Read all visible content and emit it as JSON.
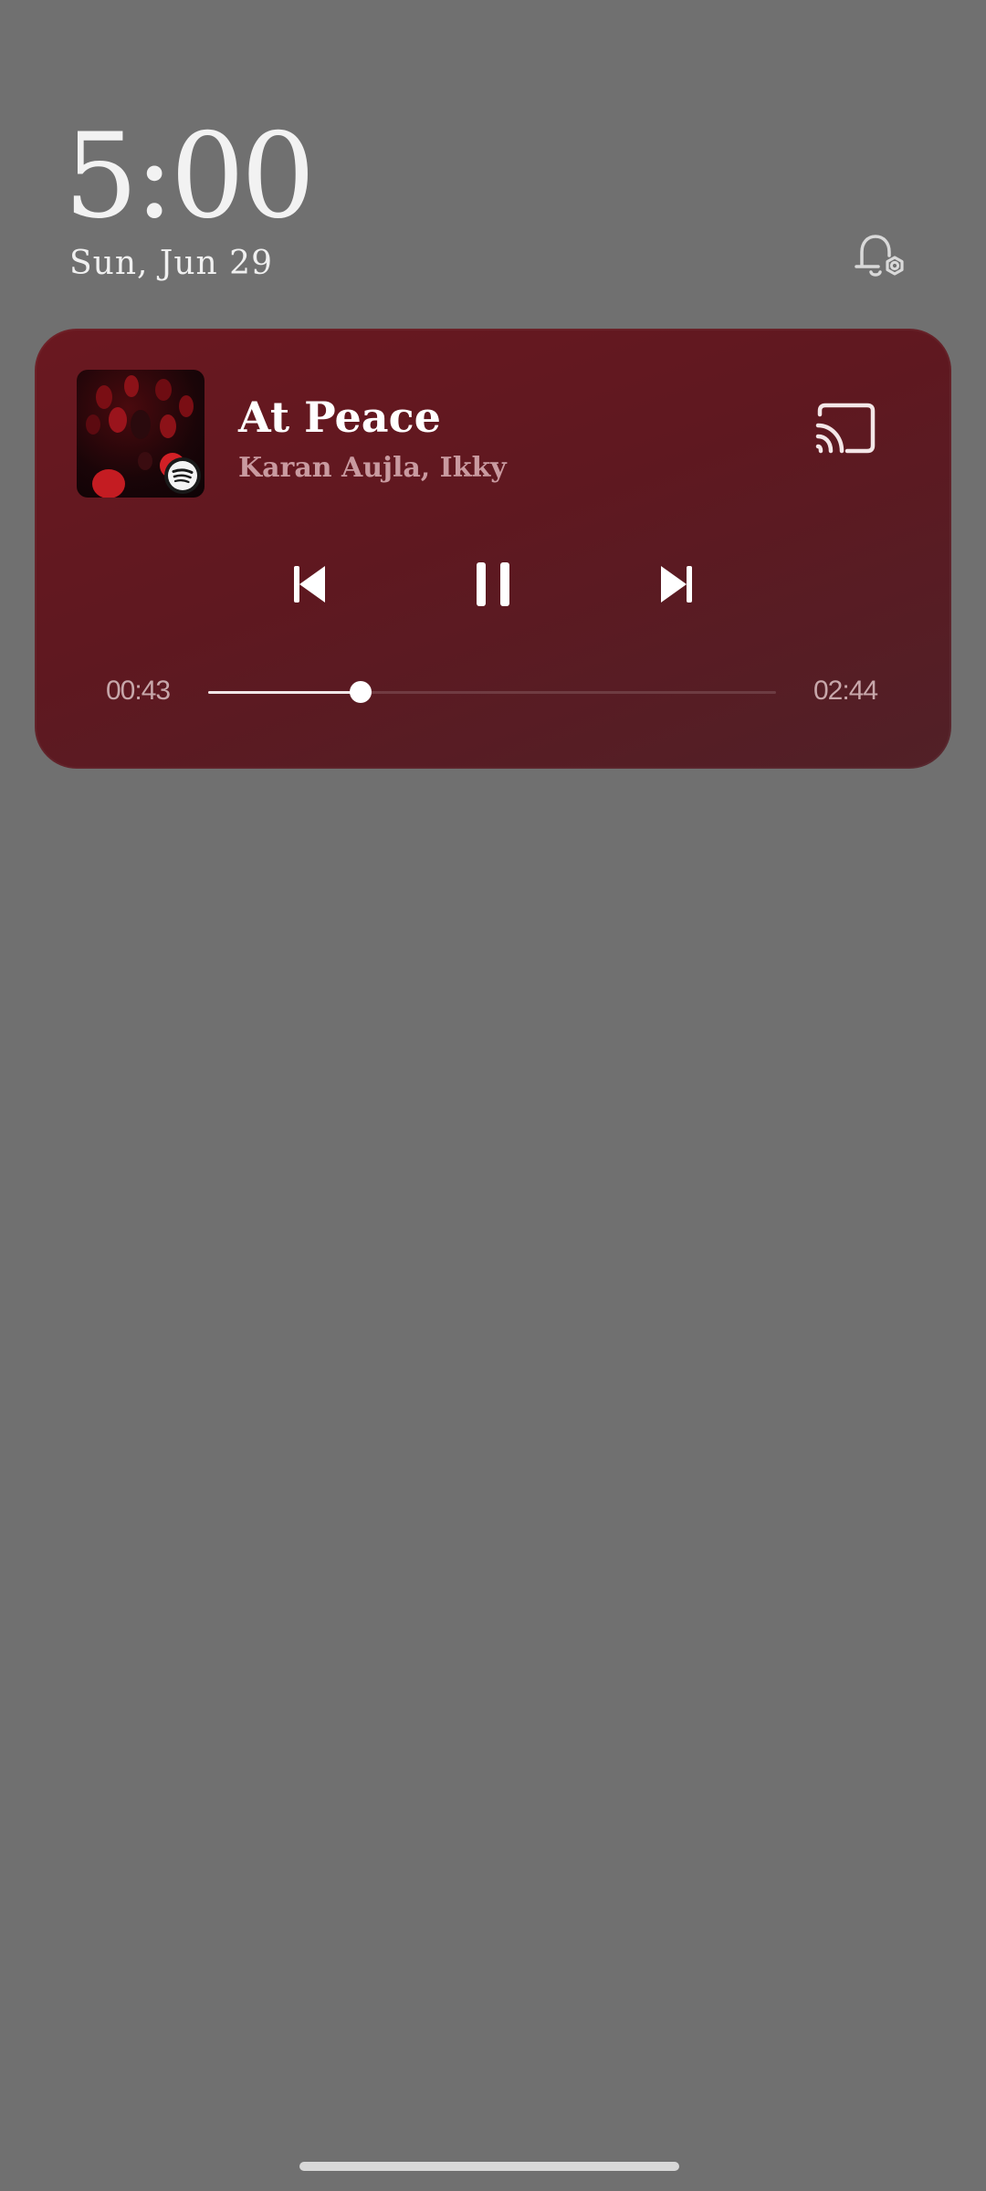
{
  "lockscreen": {
    "time": "5:00",
    "date": "Sun, Jun 29"
  },
  "media": {
    "app": "Spotify",
    "title": "At Peace",
    "artist": "Karan Aujla, Ikky",
    "elapsed": "00:43",
    "duration": "02:44",
    "progress_fraction": 0.269,
    "state": "playing"
  },
  "icons": {
    "notification_settings": "bell-settings-icon",
    "cast": "cast-icon",
    "previous": "skip-previous-icon",
    "pause": "pause-icon",
    "next": "skip-next-icon",
    "app_badge": "spotify-icon"
  },
  "colors": {
    "background": "#707070",
    "card": "#5f1820",
    "accent_text": "#c99aa0"
  }
}
